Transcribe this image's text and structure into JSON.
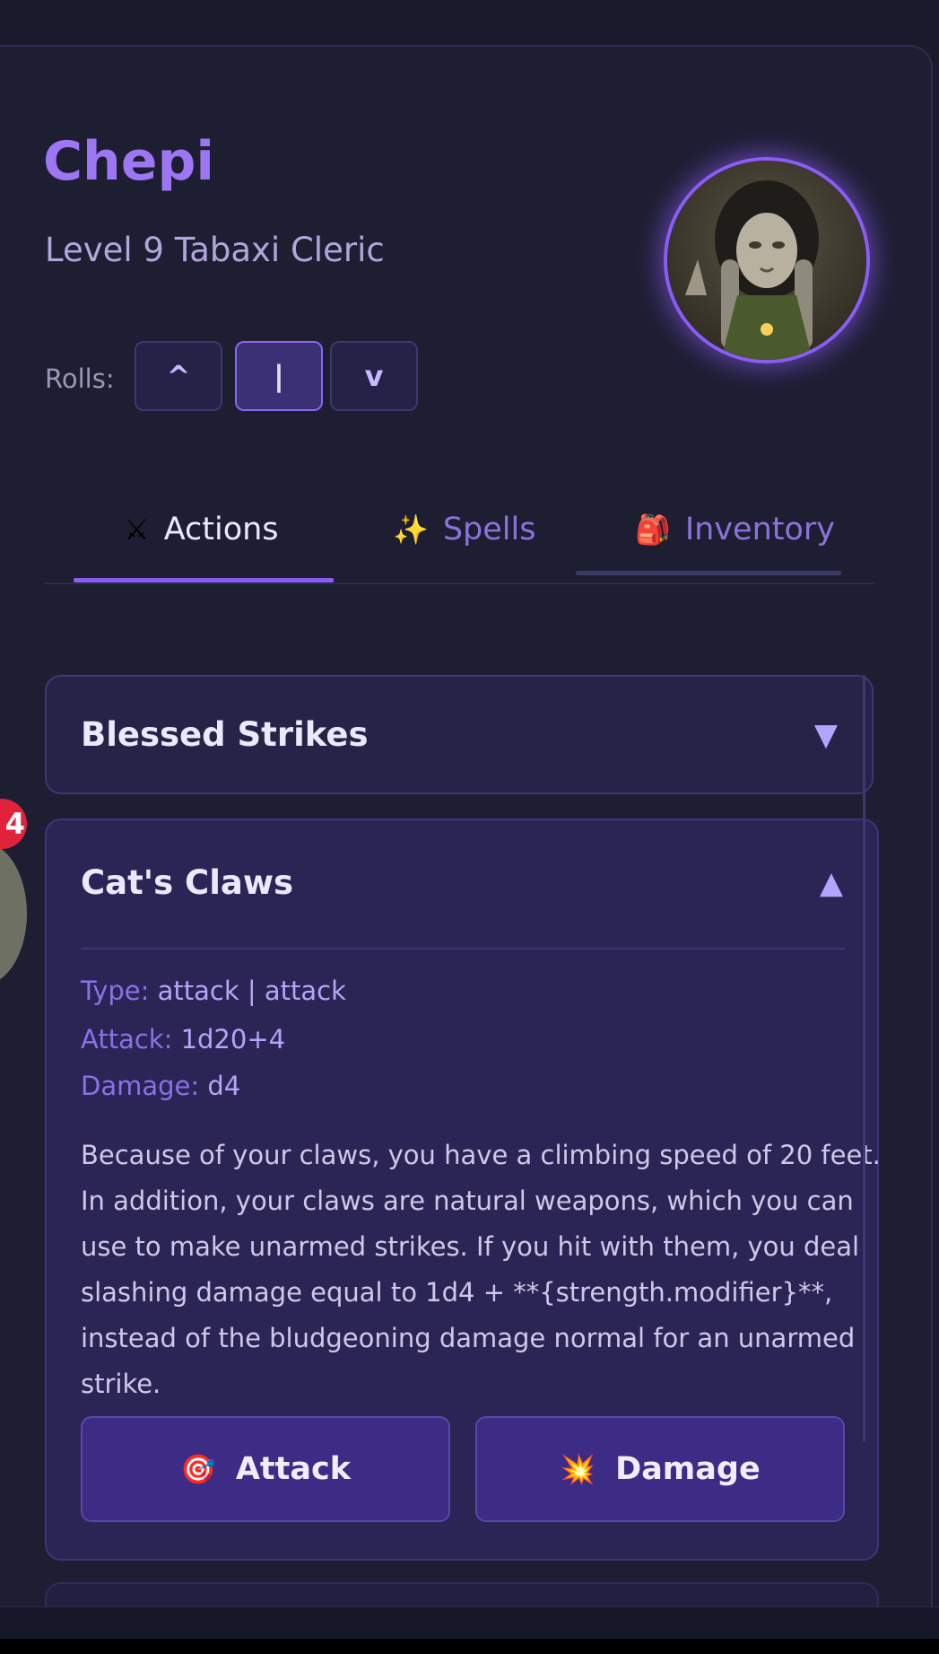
{
  "character": {
    "name": "Chepi",
    "subtitle": "Level 9 Tabaxi Cleric"
  },
  "rolls": {
    "label": "Rolls:",
    "buttons": [
      "^",
      "|",
      "v"
    ],
    "selected": "|"
  },
  "tabs": [
    {
      "icon": "⚔",
      "icon_name": "crossed-swords-icon",
      "label": "Actions",
      "active": true
    },
    {
      "icon": "✨",
      "icon_name": "sparkles-icon",
      "label": "Spells",
      "active": false
    },
    {
      "icon": "🎒",
      "icon_name": "backpack-icon",
      "label": "Inventory",
      "active": false
    }
  ],
  "actions": [
    {
      "title": "Blessed Strikes",
      "caret": "▼",
      "expanded": false
    },
    {
      "title": "Cat's Claws",
      "caret": "▲",
      "expanded": true,
      "type_label": "Type:",
      "type_value": "attack | attack",
      "attack_label": "Attack:",
      "attack_value": "1d20+4",
      "damage_label": "Damage:",
      "damage_value": "d4",
      "description": "Because of your claws, you have a climbing speed of 20 feet. In addition, your claws are natural weapons, which you can use to make unarmed strikes. If you hit with them, you deal slashing damage equal to 1d4 + **{strength.modifier}**, instead of the bludgeoning damage normal for an unarmed strike.",
      "buttons": {
        "attack_icon": "🎯",
        "attack_label": "Attack",
        "damage_icon": "💥",
        "damage_label": "Damage"
      }
    }
  ],
  "notification": {
    "count": "4"
  },
  "colors": {
    "accent": "#8b5cf6",
    "background": "#1e1e33",
    "card": "#252347",
    "card_expanded": "#2b2556",
    "badge": "#e0233b"
  }
}
